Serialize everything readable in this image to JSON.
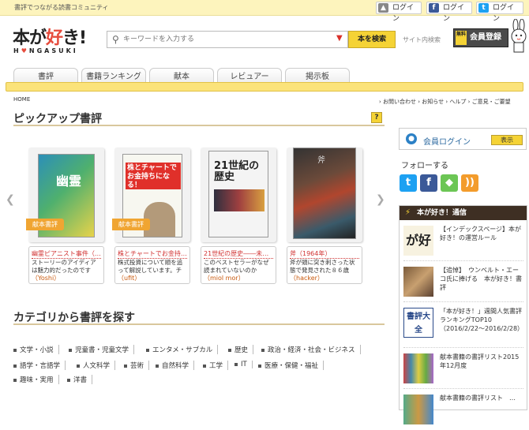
{
  "header": {
    "tagline": "書評でつながる読書コミュニティ",
    "login_labels": [
      "ログイン",
      "ログイン",
      "ログイン"
    ],
    "logo_main": "本が好き!",
    "logo_sub": "HONGASUKI",
    "search_placeholder": "キーワードを入力する",
    "search_button": "本を検索",
    "site_search": "サイト内検索",
    "register_free": "無料",
    "register_label": "会員登録"
  },
  "tabs": [
    "書評",
    "書籍ランキング",
    "献本",
    "レビュアー",
    "掲示板"
  ],
  "breadcrumb": "HOME",
  "top_links": "› お問い合わせ › お知らせ › ヘルプ › ご意見・ご要望",
  "pickup": {
    "title": "ピックアップ書評",
    "help": "?",
    "books": [
      {
        "ribbon": "献本書評",
        "title": "幽霊ピアニスト事件（…",
        "desc": "ストーリーのアイディアは魅力的だったのですが…",
        "user": "（Yoshi）"
      },
      {
        "ribbon": "献本書評",
        "title": "株とチャートでお金持ち…",
        "desc": "株式投資について順を追って解説しています。チャ…",
        "user": "（ufit）"
      },
      {
        "ribbon": "",
        "title": "21世紀の歴史――未来…",
        "desc": "このベストセラーがなぜ読まれていないのか",
        "user": "（miol mor）"
      },
      {
        "ribbon": "",
        "title": "斧（1964年）",
        "desc": "斧が頭に突き刺さった状態で発見された８６歳の…",
        "user": "（hacker）"
      }
    ],
    "cover_texts": [
      "幽霊",
      "株とチャートでお金持ちになる！",
      "21世紀の歴史",
      "斧"
    ]
  },
  "categories": {
    "title": "カテゴリから書評を探す",
    "items": [
      "文学・小説",
      "児童書・児童文学",
      "エンタメ・サブカル",
      "歴史",
      "政治・経済・社会・ビジネス",
      "語学・言語学",
      "人文科学",
      "芸術",
      "自然科学",
      "工学",
      "IT",
      "医療・保健・福祉",
      "趣味・実用",
      "洋書"
    ]
  },
  "sidebar": {
    "member_login": "会員ログイン",
    "show_button": "表示",
    "follow": "フォローする",
    "social_icons": [
      "twitter-icon",
      "facebook-icon",
      "feedly-icon",
      "rss-icon"
    ],
    "news_title": "本が好き！通信",
    "news": [
      {
        "title": "【インデックスページ】本が好き！の運営ルール",
        "thumb": "が好"
      },
      {
        "title": "【追悼】　ウンベルト・エーコ氏に捧げる　本が好き！書評",
        "thumb": ""
      },
      {
        "title": "「本が好き！」週間人気書評ランキングTOP10（2016/2/22〜2016/2/28）",
        "thumb": "書評大全"
      },
      {
        "title": "献本書籍の書評リスト2015年12月度",
        "thumb": ""
      },
      {
        "title": "献本書籍の書評リスト　…",
        "thumb": ""
      }
    ]
  },
  "colors": {
    "accent": "#f5d335",
    "red": "#d13232",
    "brand_dark": "#3e2f23"
  }
}
